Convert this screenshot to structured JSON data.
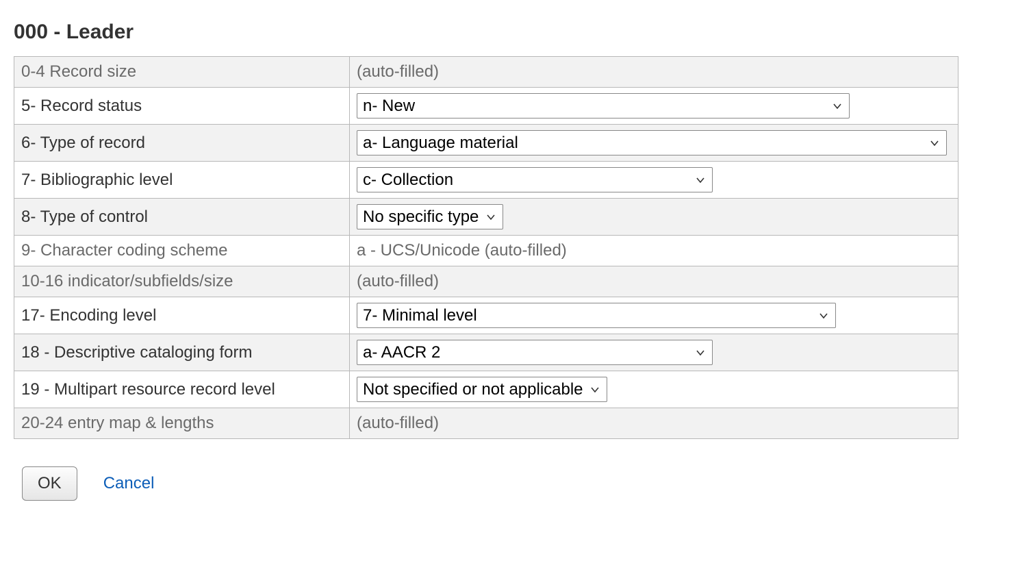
{
  "title": "000 - Leader",
  "rows": [
    {
      "id": "record-size",
      "label": "0-4 Record size",
      "type": "static",
      "muted": true,
      "value": "(auto-filled)"
    },
    {
      "id": "record-status",
      "label": "5- Record status",
      "type": "select",
      "css": "wide-1",
      "value": "n- New"
    },
    {
      "id": "type-of-record",
      "label": "6- Type of record",
      "type": "select",
      "css": "wide-2",
      "value": "a- Language material"
    },
    {
      "id": "bibliographic-level",
      "label": "7- Bibliographic level",
      "type": "select",
      "css": "wide-3",
      "value": "c- Collection"
    },
    {
      "id": "type-of-control",
      "label": "8- Type of control",
      "type": "select",
      "css": "",
      "value": "No specific type"
    },
    {
      "id": "char-coding-scheme",
      "label": "9- Character coding scheme",
      "type": "static",
      "muted": true,
      "value": "a - UCS/Unicode (auto-filled)"
    },
    {
      "id": "indicator-subfields-size",
      "label": "10-16 indicator/subfields/size",
      "type": "static",
      "muted": true,
      "value": "(auto-filled)"
    },
    {
      "id": "encoding-level",
      "label": "17- Encoding level",
      "type": "select",
      "css": "wide-5",
      "value": "7- Minimal level"
    },
    {
      "id": "descr-catalog-form",
      "label": "18 - Descriptive cataloging form",
      "type": "select",
      "css": "wide-3",
      "value": "a- AACR 2"
    },
    {
      "id": "multipart-level",
      "label": "19 - Multipart resource record level",
      "type": "select",
      "css": "",
      "value": "Not specified or not applicable"
    },
    {
      "id": "entry-map-lengths",
      "label": "20-24 entry map & lengths",
      "type": "static",
      "muted": true,
      "value": "(auto-filled)"
    }
  ],
  "actions": {
    "ok_label": "OK",
    "cancel_label": "Cancel"
  }
}
